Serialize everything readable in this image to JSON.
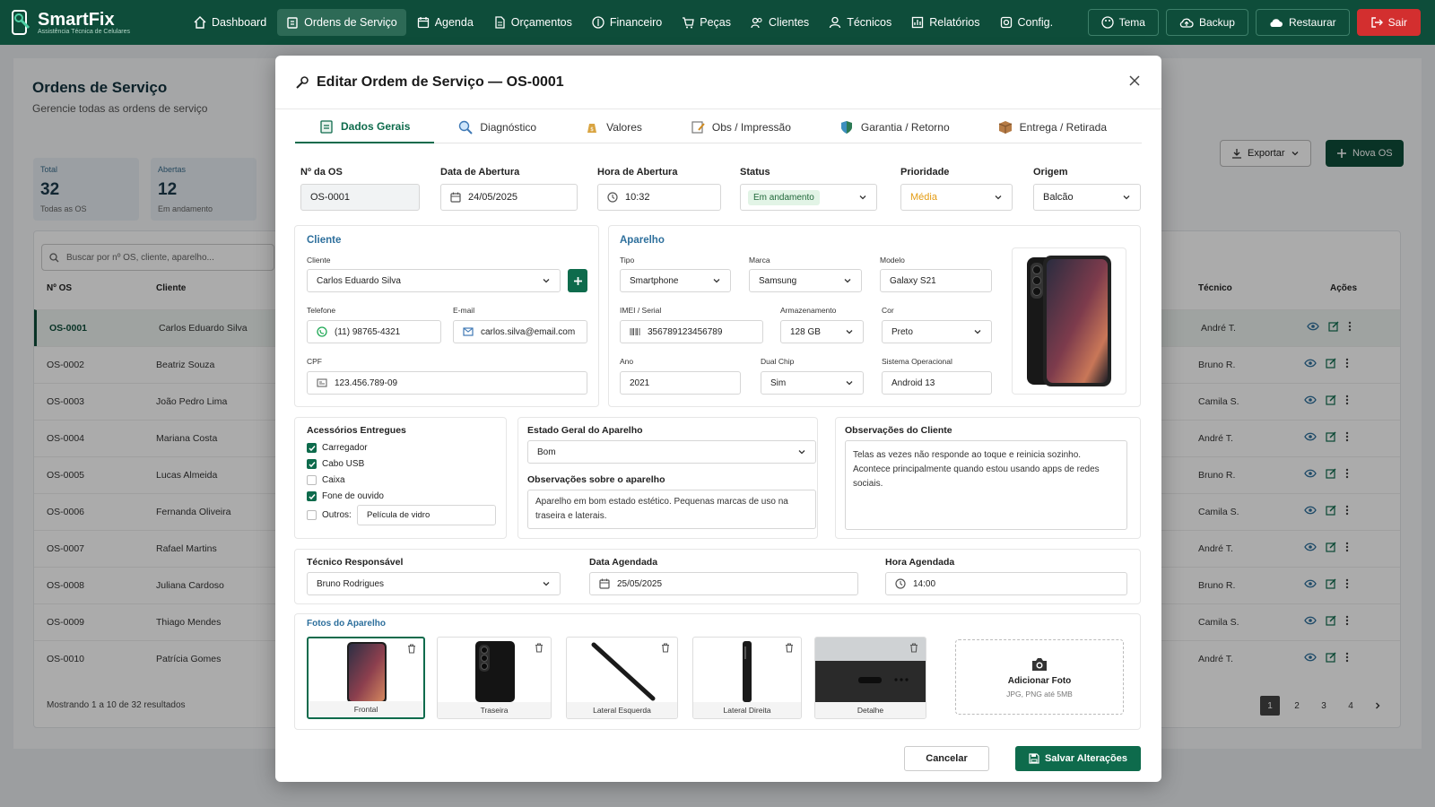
{
  "app": {
    "name": "SmartFix",
    "subtitle": "Assistência Técnica de Celulares"
  },
  "nav": [
    {
      "label": "Dashboard",
      "icon": "home-icon"
    },
    {
      "label": "Ordens de Serviço",
      "icon": "clipboard-icon",
      "active": true
    },
    {
      "label": "Agenda",
      "icon": "calendar-icon"
    },
    {
      "label": "Orçamentos",
      "icon": "document-icon"
    },
    {
      "label": "Financeiro",
      "icon": "money-icon"
    },
    {
      "label": "Peças",
      "icon": "cart-icon"
    },
    {
      "label": "Clientes",
      "icon": "users-icon"
    },
    {
      "label": "Técnicos",
      "icon": "user-icon"
    },
    {
      "label": "Relatórios",
      "icon": "chart-icon"
    },
    {
      "label": "Config.",
      "icon": "gear-icon"
    }
  ],
  "nav_right": {
    "tema": "Tema",
    "backup": "Backup",
    "restaurar": "Restaurar",
    "sair": "Sair"
  },
  "background": {
    "title": "Ordens de Serviço",
    "subtitle": "Gerencie todas as ordens de serviço",
    "stats": [
      {
        "label": "Total",
        "value": "32",
        "sub": "Todas as OS"
      },
      {
        "label": "Abertas",
        "value": "12",
        "sub": "Em andamento"
      }
    ],
    "search_placeholder": "Buscar por nº OS, cliente, aparelho...",
    "export": "Exportar",
    "new_os": "Nova OS",
    "headers": {
      "os": "Nº OS",
      "cliente": "Cliente",
      "tecnico": "Técnico",
      "acoes": "Ações"
    },
    "rows": [
      {
        "os": "OS-0001",
        "cliente": "Carlos Eduardo Silva",
        "tecnico": "André T."
      },
      {
        "os": "OS-0002",
        "cliente": "Beatriz Souza",
        "tecnico": "Bruno R."
      },
      {
        "os": "OS-0003",
        "cliente": "João Pedro Lima",
        "tecnico": "Camila S."
      },
      {
        "os": "OS-0004",
        "cliente": "Mariana Costa",
        "tecnico": "André T."
      },
      {
        "os": "OS-0005",
        "cliente": "Lucas Almeida",
        "tecnico": "Bruno R."
      },
      {
        "os": "OS-0006",
        "cliente": "Fernanda Oliveira",
        "tecnico": "Camila S."
      },
      {
        "os": "OS-0007",
        "cliente": "Rafael Martins",
        "tecnico": "André T."
      },
      {
        "os": "OS-0008",
        "cliente": "Juliana Cardoso",
        "tecnico": "Bruno R."
      },
      {
        "os": "OS-0009",
        "cliente": "Thiago Mendes",
        "tecnico": "Camila S."
      },
      {
        "os": "OS-0010",
        "cliente": "Patrícia Gomes",
        "tecnico": "André T."
      }
    ],
    "footer": "Mostrando 1 a 10 de 32 resultados",
    "pages": [
      "1",
      "2",
      "3",
      "4"
    ]
  },
  "modal": {
    "title": "Editar Ordem de Serviço — OS-0001",
    "tabs": [
      {
        "label": "Dados Gerais",
        "icon": "clipboard-icon"
      },
      {
        "label": "Diagnóstico",
        "icon": "magnifier-icon"
      },
      {
        "label": "Valores",
        "icon": "money-bag-icon"
      },
      {
        "label": "Obs / Impressão",
        "icon": "notepad-icon"
      },
      {
        "label": "Garantia / Retorno",
        "icon": "shield-icon"
      },
      {
        "label": "Entrega / Retirada",
        "icon": "package-icon"
      }
    ],
    "fields": {
      "os_label": "Nº da OS",
      "os_value": "OS-0001",
      "data_label": "Data de Abertura",
      "data_value": "24/05/2025",
      "hora_label": "Hora de Abertura",
      "hora_value": "10:32",
      "status_label": "Status",
      "status_value": "Em andamento",
      "prioridade_label": "Prioridade",
      "prioridade_value": "Média",
      "origem_label": "Origem",
      "origem_value": "Balcão"
    },
    "cliente": {
      "section": "Cliente",
      "cliente_label": "Cliente",
      "cliente_value": "Carlos Eduardo Silva",
      "telefone_label": "Telefone",
      "telefone_value": "(11) 98765-4321",
      "email_label": "E-mail",
      "email_value": "carlos.silva@email.com",
      "cpf_label": "CPF",
      "cpf_value": "123.456.789-09"
    },
    "aparelho": {
      "section": "Aparelho",
      "tipo_label": "Tipo",
      "tipo_value": "Smartphone",
      "marca_label": "Marca",
      "marca_value": "Samsung",
      "modelo_label": "Modelo",
      "modelo_value": "Galaxy S21",
      "imei_label": "IMEI / Serial",
      "imei_value": "356789123456789",
      "arm_label": "Armazenamento",
      "arm_value": "128 GB",
      "cor_label": "Cor",
      "cor_value": "Preto",
      "ano_label": "Ano",
      "ano_value": "2021",
      "dual_label": "Dual Chip",
      "dual_value": "Sim",
      "so_label": "Sistema Operacional",
      "so_value": "Android 13"
    },
    "acessorios": {
      "title": "Acessórios Entregues",
      "items": [
        {
          "label": "Carregador",
          "checked": true
        },
        {
          "label": "Cabo USB",
          "checked": true
        },
        {
          "label": "Caixa",
          "checked": false
        },
        {
          "label": "Fone de ouvido",
          "checked": true
        }
      ],
      "outros_label": "Outros:",
      "outros_value": "Película de vidro"
    },
    "estado": {
      "title": "Estado Geral do Aparelho",
      "value": "Bom",
      "obs_title": "Observações sobre o aparelho",
      "obs_value": "Aparelho em bom estado estético. Pequenas marcas de uso na traseira e laterais."
    },
    "obs_cliente": {
      "title": "Observações do Cliente",
      "value": "Telas as vezes não responde ao toque e reinicia sozinho. Acontece principalmente quando estou usando apps de redes sociais."
    },
    "tecnico": {
      "label": "Técnico Responsável",
      "value": "Bruno Rodrigues",
      "data_label": "Data Agendada",
      "data_value": "25/05/2025",
      "hora_label": "Hora Agendada",
      "hora_value": "14:00"
    },
    "fotos": {
      "title": "Fotos do Aparelho",
      "items": [
        {
          "label": "Frontal"
        },
        {
          "label": "Traseira"
        },
        {
          "label": "Lateral Esquerda"
        },
        {
          "label": "Lateral Direita"
        },
        {
          "label": "Detalhe"
        }
      ],
      "add_label": "Adicionar Foto",
      "add_sub": "JPG, PNG até 5MB"
    },
    "cancel": "Cancelar",
    "save": "Salvar Alterações"
  },
  "colors": {
    "primary": "#0e4d3a",
    "accent": "#0e6b4c",
    "danger": "#d32f2f",
    "link": "#2d6f9c",
    "warning": "#e39b12"
  }
}
